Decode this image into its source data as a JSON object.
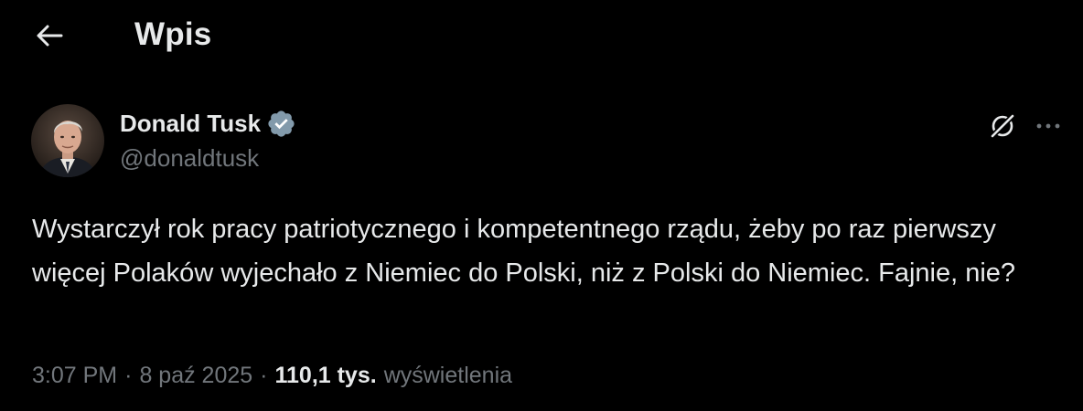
{
  "header": {
    "title": "Wpis",
    "back_icon": "arrow-left-icon"
  },
  "author": {
    "display_name": "Donald Tusk",
    "handle": "@donaldtusk",
    "verified_icon": "verified-badge-icon",
    "verified_color": "#829aab"
  },
  "actions": {
    "grok_icon": "grok-icon",
    "more_icon": "more-horizontal-icon"
  },
  "tweet": {
    "text": "Wystarczył rok pracy patriotycznego i kompetentnego rządu, żeby po raz pierwszy więcej Polaków wyjechało z Niemiec do Polski, niż z Polski do Niemiec. Fajnie, nie?"
  },
  "meta": {
    "time": "3:07 PM",
    "separator": "·",
    "date": "8 paź 2025",
    "views_count": "110,1 tys.",
    "views_label": "wyświetlenia"
  },
  "colors": {
    "background": "#000000",
    "primary_text": "#e7e9ea",
    "secondary_text": "#71767b"
  }
}
